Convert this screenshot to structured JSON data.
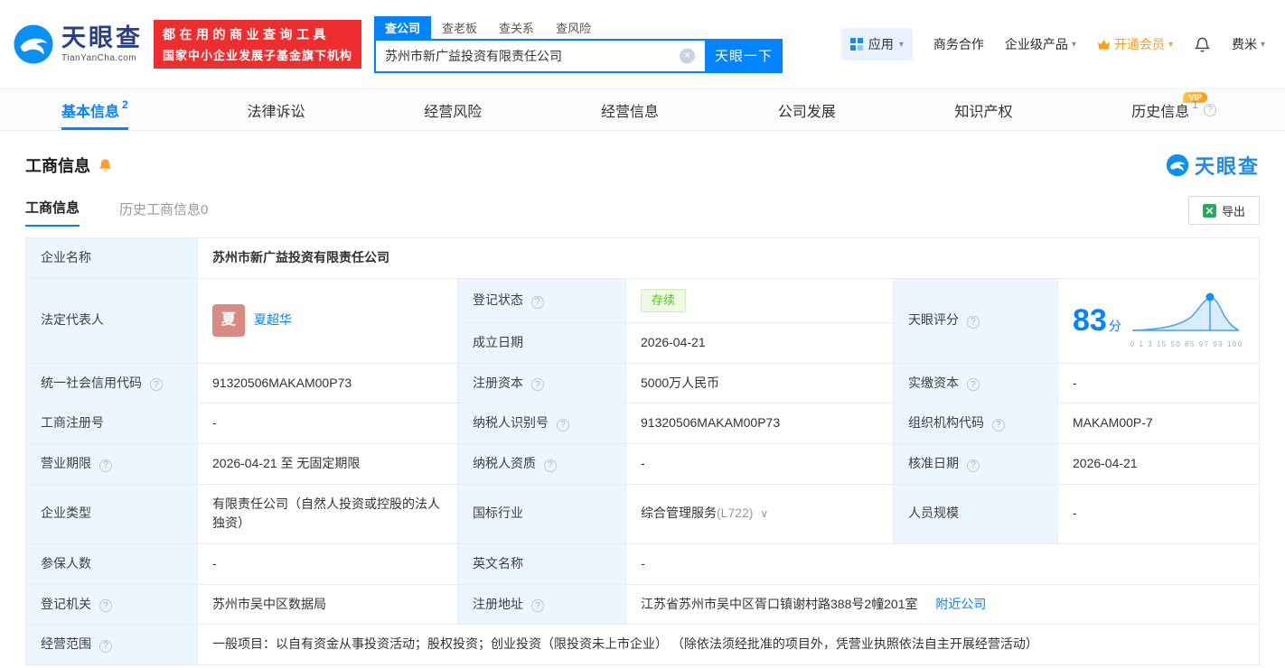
{
  "brand": {
    "name": "天眼查",
    "domain": "TianYanCha.com"
  },
  "header": {
    "slogan": {
      "line1": "都在用的商业查询工具",
      "line2": "国家中小企业发展子基金旗下机构"
    },
    "search_tabs": [
      "查公司",
      "查老板",
      "查关系",
      "查风险"
    ],
    "search": {
      "value": "苏州市新广益投资有限责任公司",
      "button": "天眼一下"
    },
    "nav": {
      "app": "应用",
      "cooperation": "商务合作",
      "enterprise": "企业级产品",
      "vip": "开通会员",
      "user": "费米"
    }
  },
  "tabs": {
    "basic": {
      "label": "基本信息",
      "badge": "2"
    },
    "legal": {
      "label": "法律诉讼"
    },
    "risk": {
      "label": "经营风险"
    },
    "operation": {
      "label": "经营信息"
    },
    "development": {
      "label": "公司发展"
    },
    "ip": {
      "label": "知识产权"
    },
    "history": {
      "label": "历史信息",
      "badge": "1",
      "vip_tag": "VIP"
    }
  },
  "section": {
    "title": "工商信息",
    "subtab_current": "工商信息",
    "subtab_history": "历史工商信息0",
    "export": "导出"
  },
  "info": {
    "company_name": {
      "label": "企业名称",
      "value": "苏州市新广益投资有限责任公司"
    },
    "legal_rep": {
      "label": "法定代表人",
      "avatar": "夏",
      "value": "夏超华"
    },
    "reg_status": {
      "label": "登记状态",
      "value": "存续"
    },
    "establish_date": {
      "label": "成立日期",
      "value": "2026-04-21"
    },
    "score": {
      "label": "天眼评分",
      "value": "83",
      "unit": "分",
      "axis": "0 1 3 15 50 85 97 99 100"
    },
    "credit_code": {
      "label": "统一社会信用代码",
      "value": "91320506MAKAM00P73"
    },
    "reg_capital": {
      "label": "注册资本",
      "value": "5000万人民币"
    },
    "paid_capital": {
      "label": "实缴资本",
      "value": "-"
    },
    "reg_number": {
      "label": "工商注册号",
      "value": "-"
    },
    "taxpayer_id": {
      "label": "纳税人识别号",
      "value": "91320506MAKAM00P73"
    },
    "org_code": {
      "label": "组织机构代码",
      "value": "MAKAM00P-7"
    },
    "business_term": {
      "label": "营业期限",
      "value": "2026-04-21 至 无固定期限"
    },
    "taxpayer_quality": {
      "label": "纳税人资质",
      "value": "-"
    },
    "approval_date": {
      "label": "核准日期",
      "value": "2026-04-21"
    },
    "company_type": {
      "label": "企业类型",
      "value": "有限责任公司（自然人投资或控股的法人独资）"
    },
    "industry": {
      "label": "国标行业",
      "value": "综合管理服务",
      "code": "(L722)"
    },
    "staff_size": {
      "label": "人员规模",
      "value": "-"
    },
    "insured_count": {
      "label": "参保人数",
      "value": "-"
    },
    "english_name": {
      "label": "英文名称",
      "value": "-"
    },
    "reg_authority": {
      "label": "登记机关",
      "value": "苏州市吴中区数据局"
    },
    "reg_address": {
      "label": "注册地址",
      "value": "江苏省苏州市吴中区胥口镇谢村路388号2幢201室",
      "link": "附近公司"
    },
    "business_scope": {
      "label": "经营范围",
      "value": "一般项目：以自有资金从事投资活动；股权投资；创业投资（限投资未上市企业） （除依法须经批准的项目外，凭营业执照依法自主开展经营活动）"
    }
  },
  "icons": {
    "help": "?",
    "clear": "✕",
    "caret": "▾",
    "expand": "∨"
  }
}
